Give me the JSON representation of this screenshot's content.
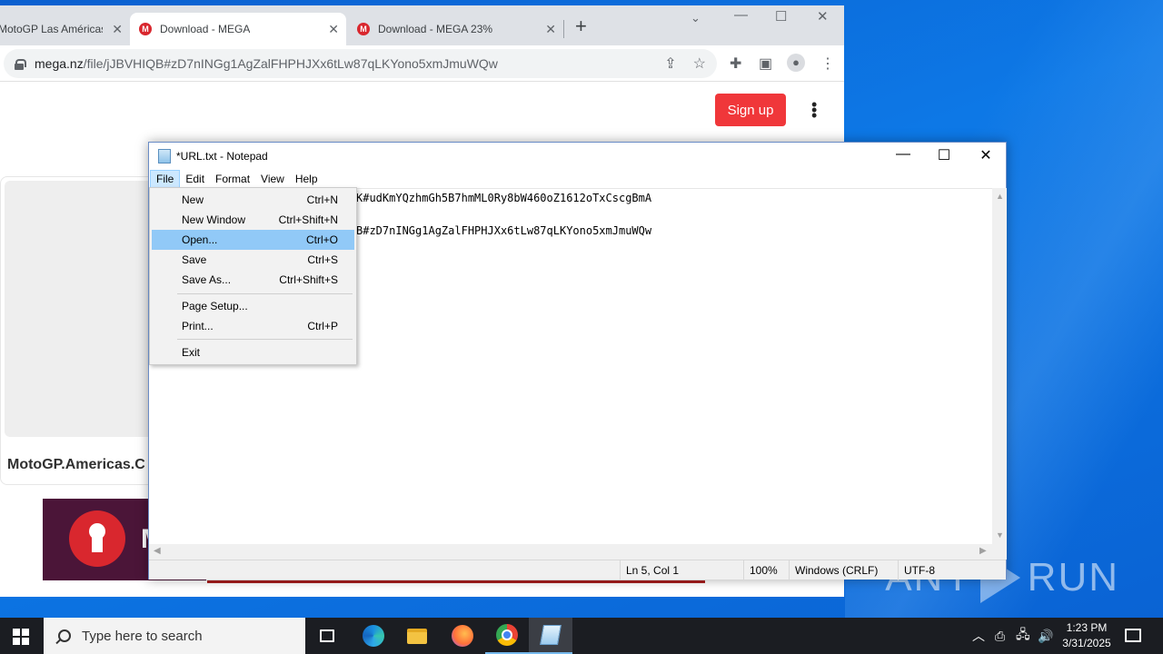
{
  "browser": {
    "tabs": [
      {
        "title": "MotoGP Las Américas",
        "favicon": "M"
      },
      {
        "title": "Download - MEGA",
        "favicon": "M"
      },
      {
        "title": "Download - MEGA 23%",
        "favicon": "M"
      }
    ],
    "url_host": "mega.nz",
    "url_path": "/file/jJBVHIQB#zD7nINGg1AgZalFHPHJXx6tLw87qLKYono5xmJmuWQw",
    "page": {
      "signup_label": "Sign up",
      "file_name": "MotoGP.Americas.C",
      "banner_letter": "M"
    }
  },
  "notepad": {
    "title": "*URL.txt - Notepad",
    "menu": [
      "File",
      "Edit",
      "Format",
      "View",
      "Help"
    ],
    "lines": [
      "K#udKmYQzhmGh5B7hmML0Ry8bW460oZ1612oTxCscgBmA",
      "B#zD7nINGg1AgZalFHPHJXx6tLw87qLKYono5xmJmuWQw"
    ],
    "status": {
      "position": "Ln 5, Col 1",
      "zoom": "100%",
      "line_ending": "Windows (CRLF)",
      "encoding": "UTF-8"
    },
    "file_menu": [
      {
        "label": "New",
        "shortcut": "Ctrl+N"
      },
      {
        "label": "New Window",
        "shortcut": "Ctrl+Shift+N"
      },
      {
        "label": "Open...",
        "shortcut": "Ctrl+O"
      },
      {
        "label": "Save",
        "shortcut": "Ctrl+S"
      },
      {
        "label": "Save As...",
        "shortcut": "Ctrl+Shift+S"
      },
      {
        "label": "Page Setup...",
        "shortcut": ""
      },
      {
        "label": "Print...",
        "shortcut": "Ctrl+P"
      },
      {
        "label": "Exit",
        "shortcut": ""
      }
    ]
  },
  "taskbar": {
    "search_placeholder": "Type here to search",
    "time": "1:23 PM",
    "date": "3/31/2025"
  },
  "watermark": {
    "left": "ANY",
    "right": "RUN"
  },
  "colors": {
    "signup": "#f0373a",
    "mega_red": "#d9272e",
    "menu_highlight": "#91c9f7",
    "taskbar": "#1b1d22"
  }
}
